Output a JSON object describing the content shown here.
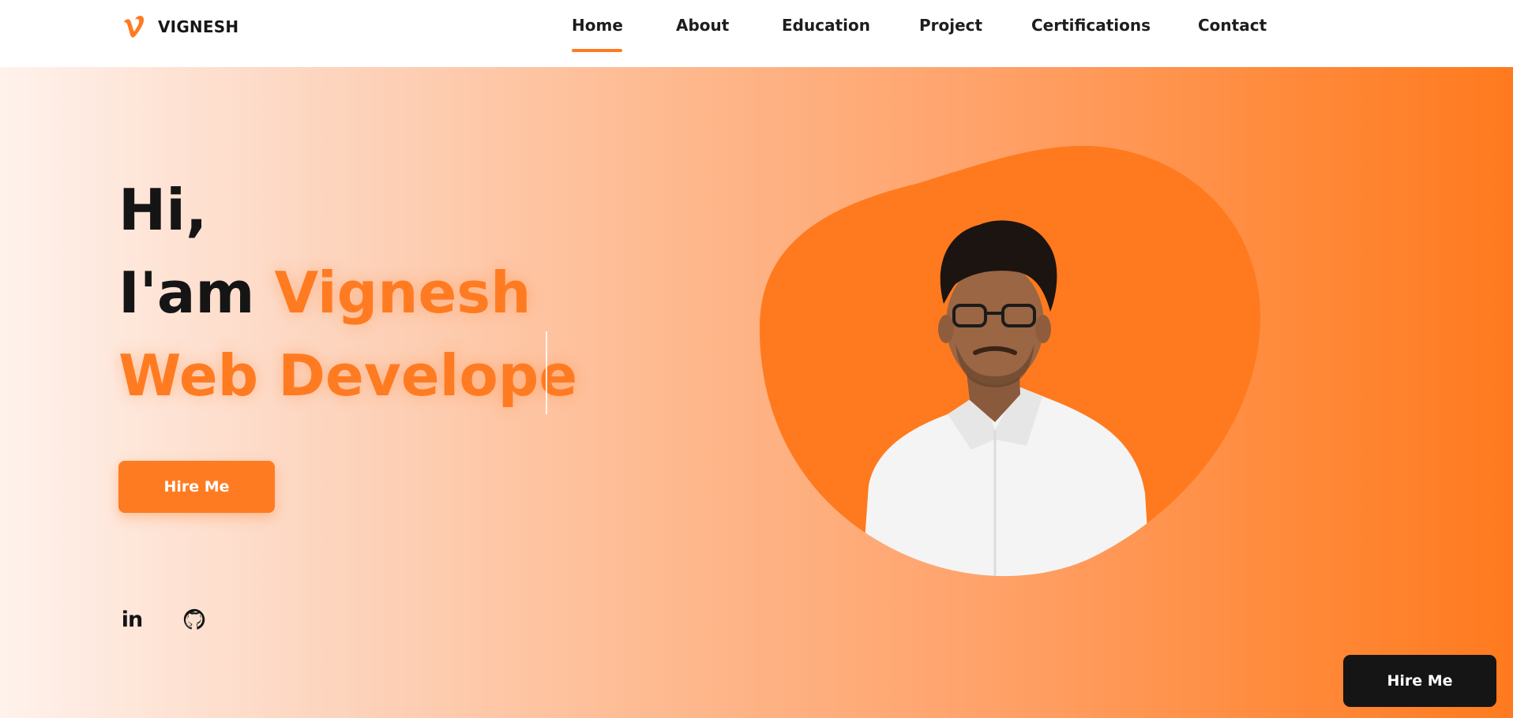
{
  "brand": {
    "name": "VIGNESH",
    "logo_icon": "vimeo-v-icon",
    "logo_color": "#ff7b22"
  },
  "nav": {
    "items": [
      {
        "label": "Home",
        "active": true
      },
      {
        "label": "About",
        "active": false
      },
      {
        "label": "Education",
        "active": false
      },
      {
        "label": "Project",
        "active": false
      },
      {
        "label": "Certifications",
        "active": false
      },
      {
        "label": "Contact",
        "active": false
      }
    ]
  },
  "hero": {
    "greeting": "Hi,",
    "intro_prefix": "I'am",
    "name": "Vignesh",
    "role_typed": "Web Develope",
    "hire_button_label": "Hire Me",
    "socials": [
      {
        "icon": "linkedin-icon",
        "text": "in"
      },
      {
        "icon": "github-icon"
      }
    ],
    "portrait": "profile-photo"
  },
  "floating_hire_label": "Hire Me",
  "colors": {
    "accent": "#ff7b22",
    "text_dark": "#151515",
    "floating_button_bg": "#151515"
  }
}
